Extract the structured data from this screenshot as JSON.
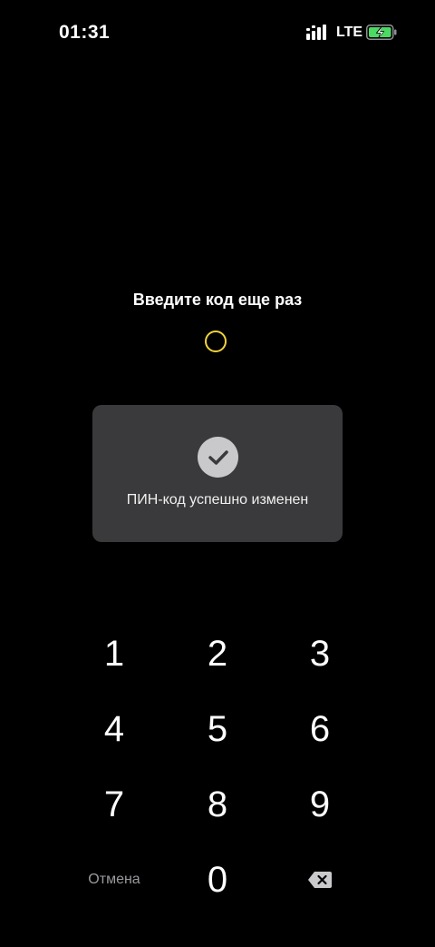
{
  "status_bar": {
    "time": "01:31",
    "network": "LTE",
    "signal_icon": "signal-icon",
    "battery_icon": "battery-charging-icon",
    "battery_color": "#4cd964"
  },
  "prompt": "Введите код еще раз",
  "pin": {
    "entered_digits": 0,
    "dot_color": "#f2d33b"
  },
  "toast": {
    "icon": "checkmark-icon",
    "message": "ПИН-код успешно изменен"
  },
  "keypad": {
    "keys": [
      "1",
      "2",
      "3",
      "4",
      "5",
      "6",
      "7",
      "8",
      "9"
    ],
    "zero": "0",
    "cancel_label": "Отмена",
    "backspace_icon": "backspace-icon"
  }
}
